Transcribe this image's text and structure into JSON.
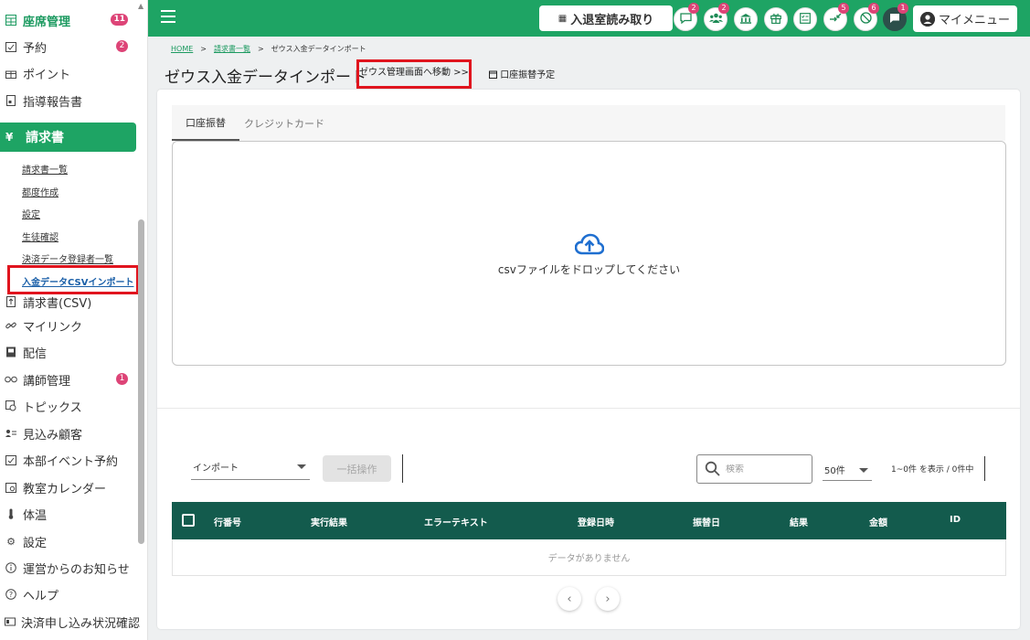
{
  "sidebar": {
    "items_top": [
      {
        "label": "座席管理",
        "icon": "seat-grid-icon",
        "badge": "11",
        "green": true
      },
      {
        "label": "予約",
        "icon": "calendar-check-icon",
        "badge": "2"
      },
      {
        "label": "ポイント",
        "icon": "gift-icon"
      },
      {
        "label": "指導報告書",
        "icon": "report-icon"
      }
    ],
    "active": {
      "label": "請求書",
      "icon": "yen-icon"
    },
    "sub_items": [
      "請求書一覧",
      "都度作成",
      "設定",
      "生徒確認",
      "決済データ登録者一覧",
      "入金データCSVインポート"
    ],
    "items_bottom": [
      {
        "label": "請求書(CSV)",
        "icon": "csv-file-icon"
      },
      {
        "label": "マイリンク",
        "icon": "link-icon"
      },
      {
        "label": "配信",
        "icon": "broadcast-icon"
      },
      {
        "label": "講師管理",
        "icon": "glasses-icon",
        "badge": "1"
      },
      {
        "label": "トピックス",
        "icon": "topics-icon"
      },
      {
        "label": "見込み顧客",
        "icon": "prospect-icon"
      },
      {
        "label": "本部イベント予約",
        "icon": "event-calendar-icon"
      },
      {
        "label": "教室カレンダー",
        "icon": "classroom-calendar-icon"
      },
      {
        "label": "体温",
        "icon": "thermometer-icon"
      },
      {
        "label": "設定",
        "icon": "gear-icon"
      },
      {
        "label": "運営からのお知らせ",
        "icon": "info-icon"
      },
      {
        "label": "ヘルプ",
        "icon": "help-icon"
      },
      {
        "label": "決済申し込み状況確認",
        "icon": "payment-status-icon"
      }
    ]
  },
  "header": {
    "scan_label": "入退室読み取り",
    "icons": [
      {
        "name": "chat-icon",
        "badge": "2"
      },
      {
        "name": "users-icon",
        "badge": "2"
      },
      {
        "name": "school-icon",
        "badge": ""
      },
      {
        "name": "gift-icon",
        "badge": ""
      },
      {
        "name": "checklist-icon",
        "badge": ""
      },
      {
        "name": "transfer-icon",
        "badge": "5"
      },
      {
        "name": "blocked-icon",
        "badge": "6"
      },
      {
        "name": "message-icon",
        "badge": "1"
      }
    ],
    "mymenu_label": "マイメニュー"
  },
  "breadcrumb": {
    "home": "HOME",
    "parent": "請求書一覧",
    "current": "ゼウス入金データインポート",
    "separator": ">"
  },
  "page": {
    "title": "ゼウス入金データインポート",
    "manage_link": "ゼウス管理画面へ移動 >>",
    "schedule_label": "口座振替予定"
  },
  "tabs": {
    "active": "口座振替",
    "inactive": "クレジットカード"
  },
  "dropzone": {
    "text": "csvファイルをドロップしてください"
  },
  "toolbar": {
    "select_value": "インポート",
    "bulk_label": "一括操作",
    "search_placeholder": "検索",
    "per_page": "50件",
    "range_text": "1~0件 を表示 / 0件中"
  },
  "table": {
    "columns": [
      "行番号",
      "実行結果",
      "エラーテキスト",
      "登録日時",
      "振替日",
      "結果",
      "金額",
      "ID"
    ],
    "empty_text": "データがありません"
  },
  "pager": {
    "prev": "‹",
    "next": "›"
  }
}
